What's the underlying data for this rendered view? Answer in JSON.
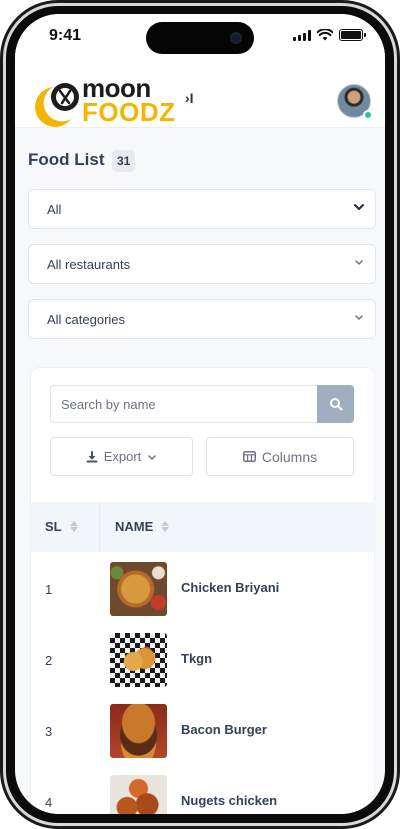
{
  "status_bar": {
    "time": "9:41"
  },
  "header": {
    "brand_line1": "moon",
    "brand_line2": "FOODZ",
    "collapse_glyph": "›I",
    "avatar_status_color": "#1fc7a5"
  },
  "page": {
    "title": "Food List",
    "count": "31"
  },
  "filters": {
    "type_value": "All",
    "restaurant_value": "All restaurants",
    "category_value": "All categories"
  },
  "search": {
    "placeholder": "Search by name",
    "icon": "search-icon"
  },
  "toolbar": {
    "export_label": "Export",
    "columns_label": "Columns"
  },
  "table": {
    "headers": {
      "sl": "SL",
      "name": "NAME"
    },
    "rows": [
      {
        "sl": "1",
        "name": "Chicken Briyani"
      },
      {
        "sl": "2",
        "name": "Tkgn"
      },
      {
        "sl": "3",
        "name": "Bacon Burger"
      },
      {
        "sl": "4",
        "name": "Nugets chicken"
      }
    ]
  },
  "colors": {
    "brand_yellow": "#f4b400",
    "text_primary": "#334257",
    "search_button": "#a1aec1",
    "table_header_bg": "#f2f5fa"
  }
}
